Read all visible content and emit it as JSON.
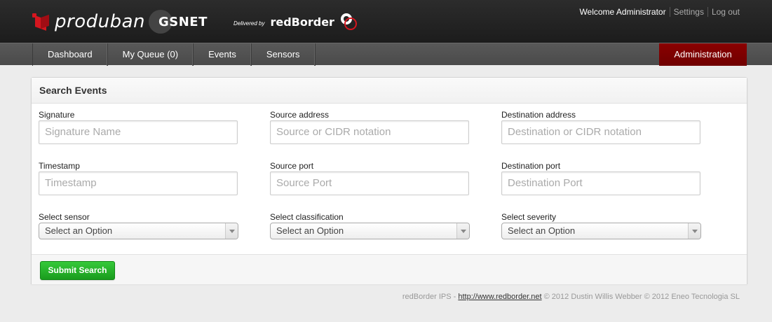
{
  "header": {
    "brand": "produban",
    "partner": "GSNET",
    "delivered_by": "Delivered by",
    "vendor": "redBorder",
    "user_nav": {
      "welcome": "Welcome Administrator",
      "settings": "Settings",
      "logout": "Log out"
    }
  },
  "nav": {
    "items": [
      {
        "label": "Dashboard"
      },
      {
        "label": "My Queue (0)"
      },
      {
        "label": "Events"
      },
      {
        "label": "Sensors"
      }
    ],
    "admin": "Administration"
  },
  "panel": {
    "title": "Search Events",
    "fields": {
      "signature": {
        "label": "Signature",
        "placeholder": "Signature Name"
      },
      "source_address": {
        "label": "Source address",
        "placeholder": "Source or CIDR notation"
      },
      "destination_address": {
        "label": "Destination address",
        "placeholder": "Destination or CIDR notation"
      },
      "timestamp": {
        "label": "Timestamp",
        "placeholder": "Timestamp"
      },
      "source_port": {
        "label": "Source port",
        "placeholder": "Source Port"
      },
      "destination_port": {
        "label": "Destination port",
        "placeholder": "Destination Port"
      },
      "sensor": {
        "label": "Select sensor",
        "value": "Select an Option"
      },
      "classification": {
        "label": "Select classification",
        "value": "Select an Option"
      },
      "severity": {
        "label": "Select severity",
        "value": "Select an Option"
      }
    },
    "submit_label": "Submit Search"
  },
  "footer": {
    "prefix": "redBorder IPS - ",
    "link": "http://www.redborder.net",
    "suffix": " © 2012 Dustin Willis Webber © 2012 Eneo Tecnologia SL"
  },
  "colors": {
    "topbar": "#1f1f1f",
    "navbar": "#515151",
    "admin_tab": "#800000",
    "submit": "#22a726",
    "brand_red": "#d5161f"
  }
}
